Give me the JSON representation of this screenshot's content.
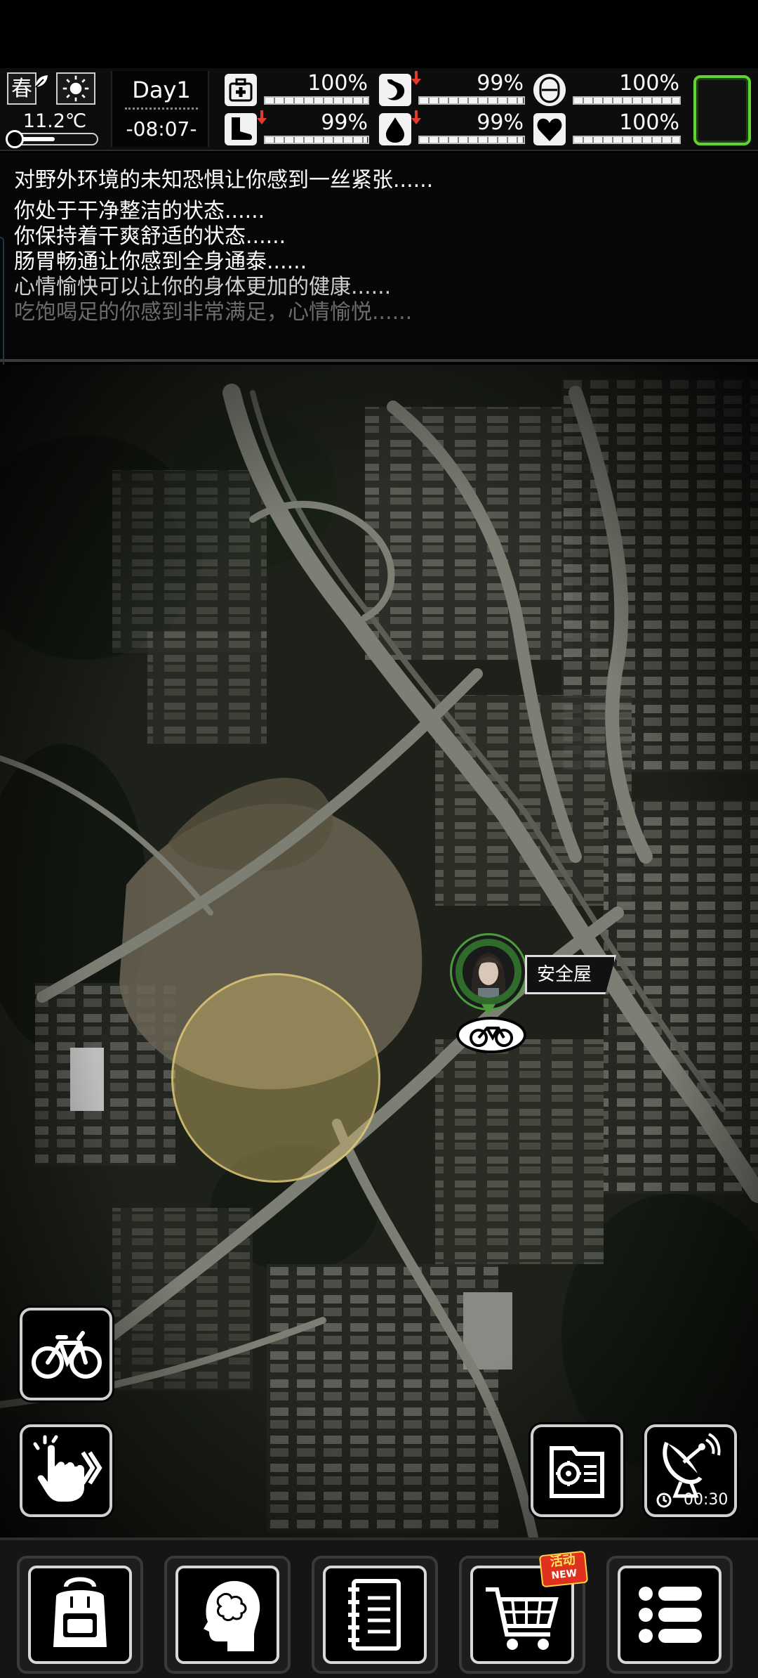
{
  "status": {
    "season": "春",
    "temperature": "11.2℃",
    "day": "Day1",
    "time": "-08:07-",
    "stats": [
      {
        "icon": "medkit-icon",
        "value": "100%",
        "level": 1.0,
        "arrow": false
      },
      {
        "icon": "stomach-icon",
        "value": "99%",
        "level": 0.99,
        "arrow": true
      },
      {
        "icon": "mood-face-icon",
        "value": "100%",
        "level": 1.0,
        "arrow": false
      },
      {
        "icon": "boot-icon",
        "value": "99%",
        "level": 0.99,
        "arrow": true
      },
      {
        "icon": "water-drop-icon",
        "value": "99%",
        "level": 0.99,
        "arrow": true
      },
      {
        "icon": "heart-icon",
        "value": "100%",
        "level": 1.0,
        "arrow": false
      }
    ],
    "arrow_color": "#e53b2f",
    "equip_slot_color": "#5ed431"
  },
  "log": {
    "messages": [
      {
        "text": "对野外环境的未知恐惧让你感到一丝紧张......",
        "color": "#ffffff"
      },
      {
        "text": "你处于干净整洁的状态......",
        "color": "#ffffff"
      },
      {
        "text": "你保持着干爽舒适的状态......",
        "color": "#ffffff"
      },
      {
        "text": "肠胃畅通让你感到全身通泰......",
        "color": "#ffffff"
      },
      {
        "text": "心情愉快可以让你的身体更加的健康......",
        "color": "#cfcfcf"
      },
      {
        "text": "吃饱喝足的你感到非常满足，心情愉悦......",
        "color": "#6c6c6c"
      }
    ]
  },
  "map": {
    "safehouse_label": "安全屋",
    "signal_timer": "00:30",
    "zone_color": "#d6be6e"
  },
  "buttons": {
    "bike": "bicycle-icon",
    "move": "tap-forward-icon",
    "map_card": "map-location-card-icon",
    "signal": "satellite-dish-icon"
  },
  "nav": {
    "items": [
      "backpack-icon",
      "brain-head-icon",
      "notebook-icon",
      "shopping-cart-icon",
      "menu-list-icon"
    ],
    "promo_top": "活动",
    "promo_bottom": "NEW"
  }
}
